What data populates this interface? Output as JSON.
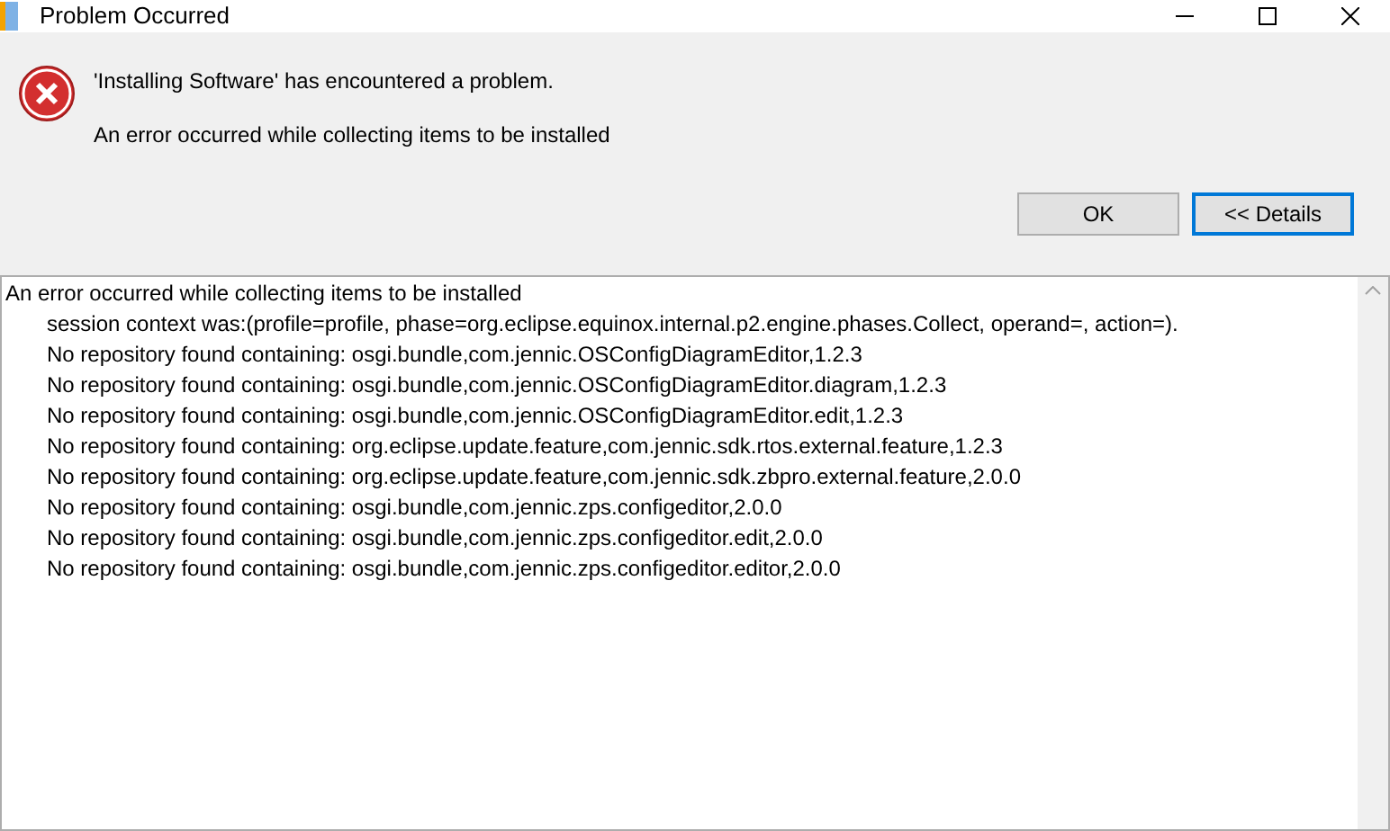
{
  "window": {
    "title": "Problem Occurred"
  },
  "message": {
    "title": "'Installing Software' has encountered a problem.",
    "detail": "An error occurred while collecting items to be installed"
  },
  "buttons": [
    {
      "label": "OK",
      "focused": false
    },
    {
      "label": "<< Details",
      "focused": true
    }
  ],
  "details": {
    "text": "An error occurred while collecting items to be installed",
    "children": [
      "session context was:(profile=profile, phase=org.eclipse.equinox.internal.p2.engine.phases.Collect, operand=, action=).",
      "No repository found containing: osgi.bundle,com.jennic.OSConfigDiagramEditor,1.2.3",
      "No repository found containing: osgi.bundle,com.jennic.OSConfigDiagramEditor.diagram,1.2.3",
      "No repository found containing: osgi.bundle,com.jennic.OSConfigDiagramEditor.edit,1.2.3",
      "No repository found containing: org.eclipse.update.feature,com.jennic.sdk.rtos.external.feature,1.2.3",
      "No repository found containing: org.eclipse.update.feature,com.jennic.sdk.zbpro.external.feature,2.0.0",
      "No repository found containing: osgi.bundle,com.jennic.zps.configeditor,2.0.0",
      "No repository found containing: osgi.bundle,com.jennic.zps.configeditor.edit,2.0.0",
      "No repository found containing: osgi.bundle,com.jennic.zps.configeditor.editor,2.0.0"
    ]
  }
}
